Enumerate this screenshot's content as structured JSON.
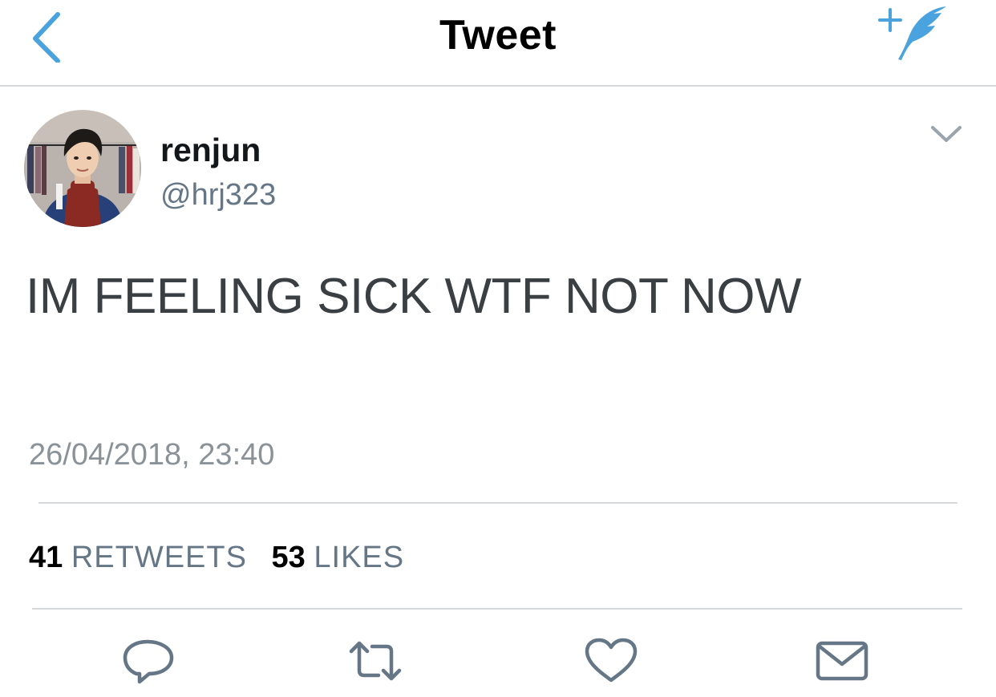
{
  "header": {
    "title": "Tweet"
  },
  "author": {
    "display_name": "renjun",
    "handle": "@hrj323"
  },
  "tweet": {
    "text": "IM FEELING SICK WTF NOT NOW",
    "timestamp": "26/04/2018, 23:40"
  },
  "stats": {
    "retweets_count": "41",
    "retweets_label": "RETWEETS",
    "likes_count": "53",
    "likes_label": "LIKES"
  },
  "colors": {
    "accent": "#4aa3df",
    "icon_gray": "#657786",
    "divider": "#d6d9dc"
  },
  "icons": {
    "back": "chevron-left-icon",
    "compose": "compose-feather-icon",
    "caret": "chevron-down-icon",
    "reply": "reply-icon",
    "retweet": "retweet-icon",
    "like": "heart-icon",
    "share": "envelope-icon"
  }
}
